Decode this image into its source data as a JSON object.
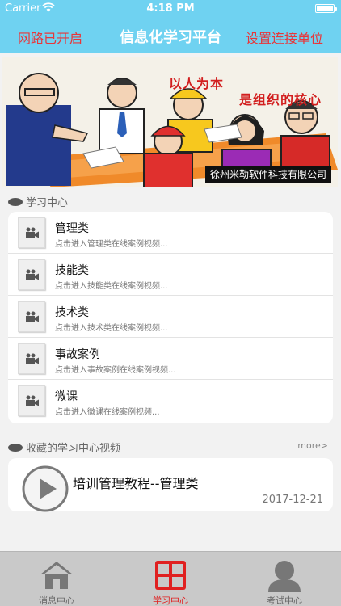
{
  "status_bar": {
    "carrier": "Carrier",
    "time": "4:18 PM"
  },
  "nav": {
    "left": "网路已开启",
    "title": "信息化学习平台",
    "right": "设置连接单位"
  },
  "banner": {
    "slogan_line1": "以人为本",
    "slogan_line2": "是组织的核心",
    "caption": "徐州米勒软件科技有限公司"
  },
  "study_center": {
    "header": "学习中心",
    "items": [
      {
        "name": "管理类",
        "desc": "点击进入管理类在线案例视频..."
      },
      {
        "name": "技能类",
        "desc": "点击进入技能类在线案例视频..."
      },
      {
        "name": "技术类",
        "desc": "点击进入技术类在线案例视频..."
      },
      {
        "name": "事故案例",
        "desc": "点击进入事故案例在线案例视频..."
      },
      {
        "name": "微课",
        "desc": "点击进入微课在线案例视频..."
      }
    ]
  },
  "favorites": {
    "header": "收藏的学习中心视频",
    "more": "more>",
    "item": {
      "title": "培训管理教程--管理类",
      "date": "2017-12-21"
    }
  },
  "tabs": [
    {
      "label": "消息中心",
      "icon": "house-icon",
      "active": false
    },
    {
      "label": "学习中心",
      "icon": "grid-icon",
      "active": true,
      "color": "#e02020"
    },
    {
      "label": "考试中心",
      "icon": "person-icon",
      "active": false
    }
  ],
  "colors": {
    "nav_bg": "#6fd2f1",
    "nav_side_text": "#e8363a",
    "tab_active": "#e02020"
  }
}
